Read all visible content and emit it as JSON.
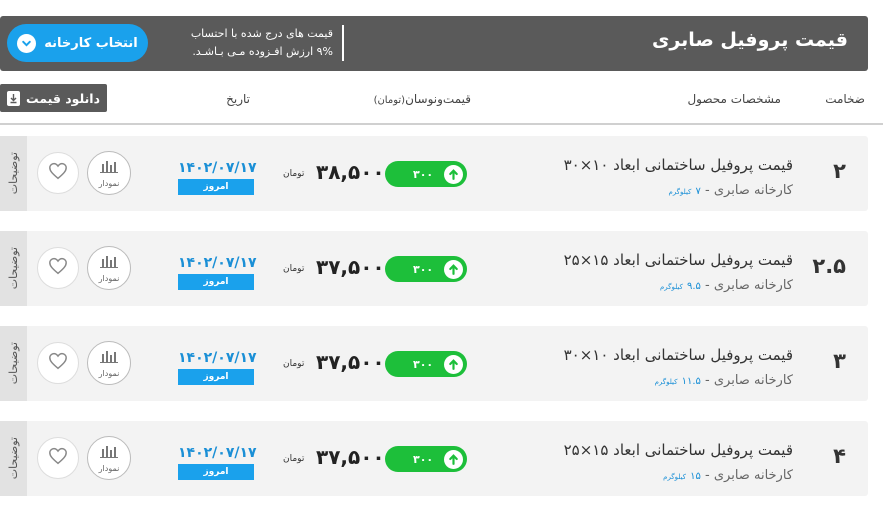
{
  "header": {
    "title": "قیمت پروفیل صابری",
    "note_line1": "قیمت های درج شده با احتساب",
    "note_line2": "۹% ارزش افـزوده مـی بـاشـد.",
    "factory_button": "انتخاب کارخانه"
  },
  "columns": {
    "thickness": "ضخامت",
    "specs": "مشخصات محصول",
    "price_change": "قیمت‌ونوسان",
    "price_unit": "(تومان)",
    "date": "تاریخ",
    "download": "دانلود قیمت"
  },
  "icons": {
    "chevron": "chevron-down-icon",
    "download": "download-icon",
    "heart": "heart-icon",
    "chart": "bar-chart-icon",
    "up": "arrow-up-icon"
  },
  "colors": {
    "header_bg": "#5a5a5a",
    "accent_blue": "#1aa1ec",
    "change_green": "#1dbf3a",
    "row_bg": "#f3f3f3"
  },
  "rows": [
    {
      "thickness": "۲",
      "title": "قیمت پروفیل ساختمانی ابعاد ۱۰×۳۰",
      "factory": "کارخانه صابری - ",
      "weight": "۷",
      "weight_unit": "کیلوگرم",
      "change": "۳۰۰",
      "price": "۳۸,۵۰۰",
      "unit": "تومان",
      "date": "۱۴۰۲/۰۷/۱۷",
      "today": "امروز",
      "chart_label": "نمودار",
      "side": "توضیحات"
    },
    {
      "thickness": "۲.۵",
      "title": "قیمت پروفیل ساختمانی ابعاد ۱۵×۲۵",
      "factory": "کارخانه صابری - ",
      "weight": "۹.۵",
      "weight_unit": "کیلوگرم",
      "change": "۳۰۰",
      "price": "۳۷,۵۰۰",
      "unit": "تومان",
      "date": "۱۴۰۲/۰۷/۱۷",
      "today": "امروز",
      "chart_label": "نمودار",
      "side": "توضیحات"
    },
    {
      "thickness": "۳",
      "title": "قیمت پروفیل ساختمانی ابعاد ۱۰×۳۰",
      "factory": "کارخانه صابری - ",
      "weight": "۱۱.۵",
      "weight_unit": "کیلوگرم",
      "change": "۳۰۰",
      "price": "۳۷,۵۰۰",
      "unit": "تومان",
      "date": "۱۴۰۲/۰۷/۱۷",
      "today": "امروز",
      "chart_label": "نمودار",
      "side": "توضیحات"
    },
    {
      "thickness": "۴",
      "title": "قیمت پروفیل ساختمانی ابعاد ۱۵×۲۵",
      "factory": "کارخانه صابری - ",
      "weight": "۱۵",
      "weight_unit": "کیلوگرم",
      "change": "۳۰۰",
      "price": "۳۷,۵۰۰",
      "unit": "تومان",
      "date": "۱۴۰۲/۰۷/۱۷",
      "today": "امروز",
      "chart_label": "نمودار",
      "side": "توضیحات"
    }
  ]
}
